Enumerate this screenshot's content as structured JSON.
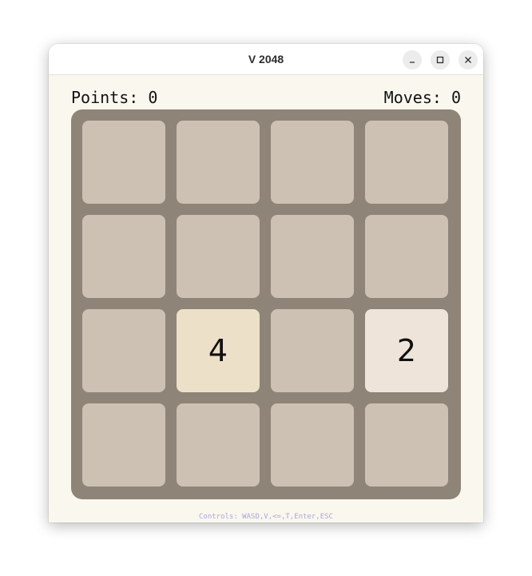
{
  "window": {
    "title": "V 2048",
    "buttons": [
      {
        "name": "minimize",
        "icon": "minimize-icon"
      },
      {
        "name": "maximize",
        "icon": "maximize-icon"
      },
      {
        "name": "close",
        "icon": "close-icon"
      }
    ]
  },
  "stats": {
    "points_label": "Points: 0",
    "moves_label": "Moves: 0"
  },
  "board": {
    "rows": [
      [
        "",
        "",
        "",
        ""
      ],
      [
        "",
        "",
        "",
        ""
      ],
      [
        "",
        "4",
        "",
        "2"
      ],
      [
        "",
        "",
        "",
        ""
      ]
    ]
  },
  "footer": {
    "controls": "Controls: WASD,V,<=,T,Enter,ESC"
  },
  "colors": {
    "board": "#8f8478",
    "empty_tile": "#cdc1b4",
    "tile_2": "#eee4da",
    "tile_4": "#ede0c8",
    "background": "#faf7ef",
    "controls_text": "#a9a6d9"
  }
}
